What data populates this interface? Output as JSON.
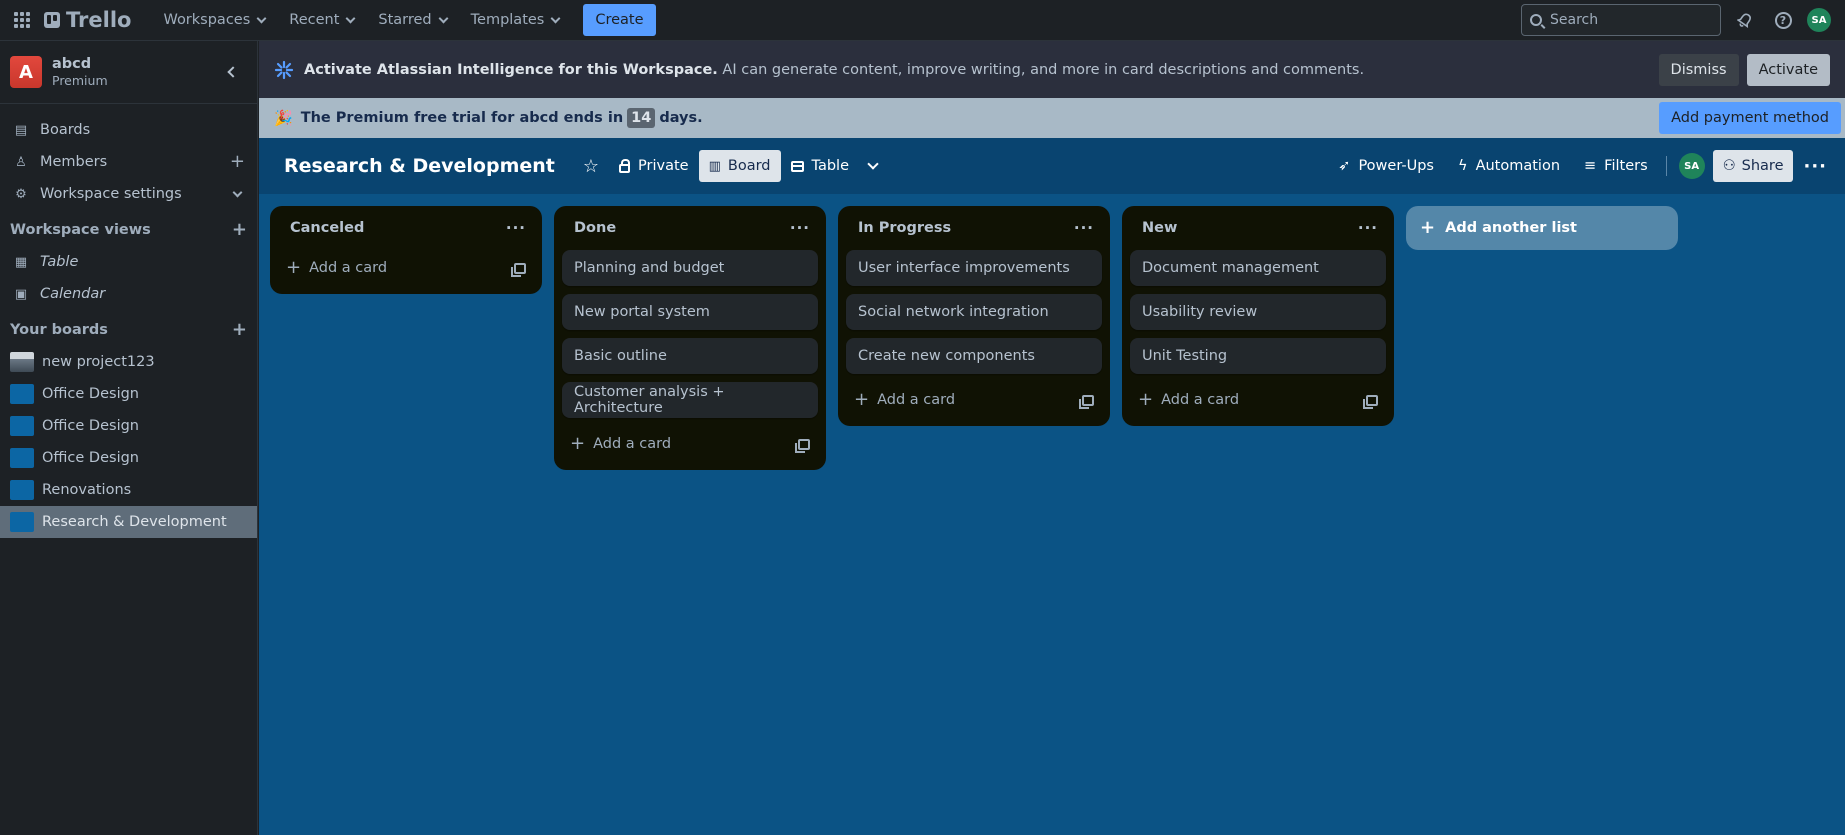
{
  "topnav": {
    "brand": "Trello",
    "menu": [
      "Workspaces",
      "Recent",
      "Starred",
      "Templates"
    ],
    "create_label": "Create",
    "search_placeholder": "Search",
    "avatar_initials": "SA"
  },
  "sidebar": {
    "workspace_initial": "A",
    "workspace_name": "abcd",
    "workspace_plan": "Premium",
    "nav": [
      {
        "label": "Boards",
        "icon": "board-icon"
      },
      {
        "label": "Members",
        "icon": "person-icon"
      },
      {
        "label": "Workspace settings",
        "icon": "gear-icon"
      }
    ],
    "views_heading": "Workspace views",
    "views": [
      {
        "label": "Table",
        "icon": "table-icon"
      },
      {
        "label": "Calendar",
        "icon": "calendar-icon"
      }
    ],
    "boards_heading": "Your boards",
    "boards": [
      {
        "label": "new project123",
        "color": "#8a9aa8"
      },
      {
        "label": "Office Design",
        "color": "#0c66a4"
      },
      {
        "label": "Office Design",
        "color": "#0c66a4"
      },
      {
        "label": "Office Design",
        "color": "#0c66a4"
      },
      {
        "label": "Renovations",
        "color": "#0c66a4"
      },
      {
        "label": "Research & Development",
        "color": "#0c66a4"
      }
    ]
  },
  "ai_banner": {
    "bold": "Activate Atlassian Intelligence for this Workspace.",
    "text": " AI can generate content, improve writing, and more in card descriptions and comments.",
    "dismiss": "Dismiss",
    "activate": "Activate"
  },
  "trial_banner": {
    "prefix": "The Premium free trial for abcd ends in",
    "days": "14",
    "suffix": "days.",
    "pay_button": "Add payment method"
  },
  "board": {
    "title": "Research & Development",
    "visibility": "Private",
    "view_board": "Board",
    "view_table": "Table",
    "power_ups": "Power-Ups",
    "automation": "Automation",
    "filters": "Filters",
    "member_initials": "SA",
    "share": "Share"
  },
  "lists": [
    {
      "title": "Canceled",
      "cards": [],
      "add_label": "Add a card"
    },
    {
      "title": "Done",
      "cards": [
        "Planning and budget",
        "New portal system",
        "Basic outline",
        "Customer analysis + Architecture"
      ],
      "add_label": "Add a card"
    },
    {
      "title": "In Progress",
      "cards": [
        "User interface improvements",
        "Social network integration",
        "Create new components"
      ],
      "add_label": "Add a card"
    },
    {
      "title": "New",
      "cards": [
        "Document management",
        "Usability review",
        "Unit Testing"
      ],
      "add_label": "Add a card"
    }
  ],
  "add_list_label": "Add another list",
  "colors": {
    "board_bg": "#0b5385",
    "header_bg": "#094470",
    "list_bg": "#101204",
    "card_bg": "#22272b",
    "accent": "#579dff"
  }
}
